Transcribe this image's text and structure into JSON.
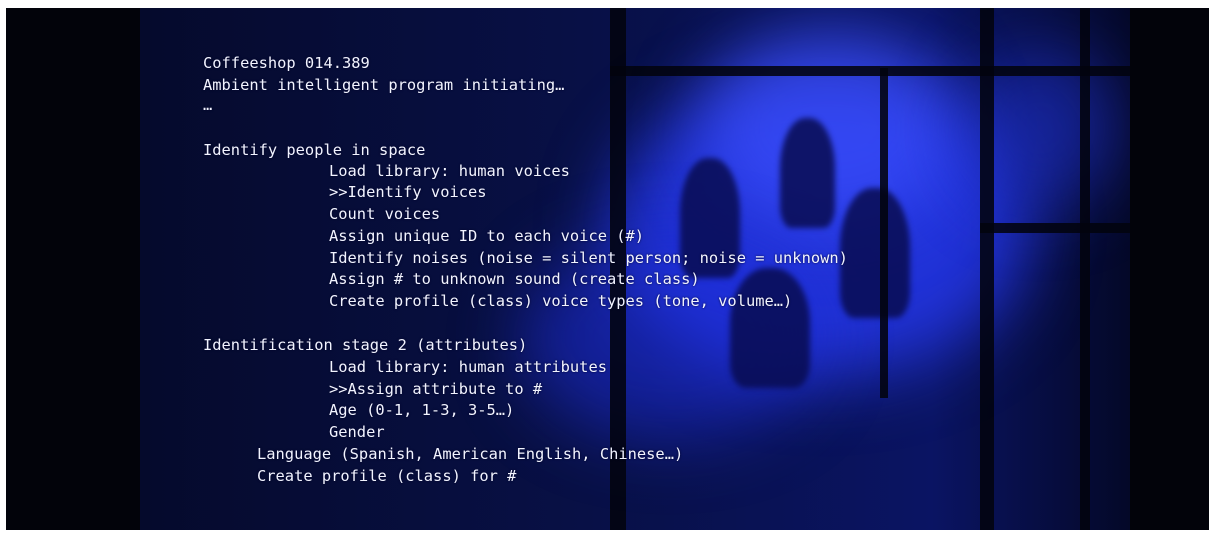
{
  "colors": {
    "background": "#02030a",
    "scene_tint": "#0a1463",
    "glow": "#2a3dff",
    "text": "#f2f4ff"
  },
  "terminal": {
    "lines": [
      "Coffeeshop 014.389",
      "Ambient intelligent program initiating…",
      "…",
      "Identify people in space",
      "Load library: human voices",
      ">>Identify voices",
      "Count voices",
      "Assign unique ID to each voice (#)",
      "Identify noises (noise = silent person; noise = unknown)",
      "Assign # to unknown sound (create class)",
      "Create profile (class) voice types (tone, volume…)",
      "Identification stage 2 (attributes)",
      "Load library: human attributes",
      ">>Assign attribute to #",
      "Age (0-1, 1-3, 3-5…)",
      "Gender",
      "Language (Spanish, American English, Chinese…)",
      "Create profile (class) for #"
    ]
  }
}
